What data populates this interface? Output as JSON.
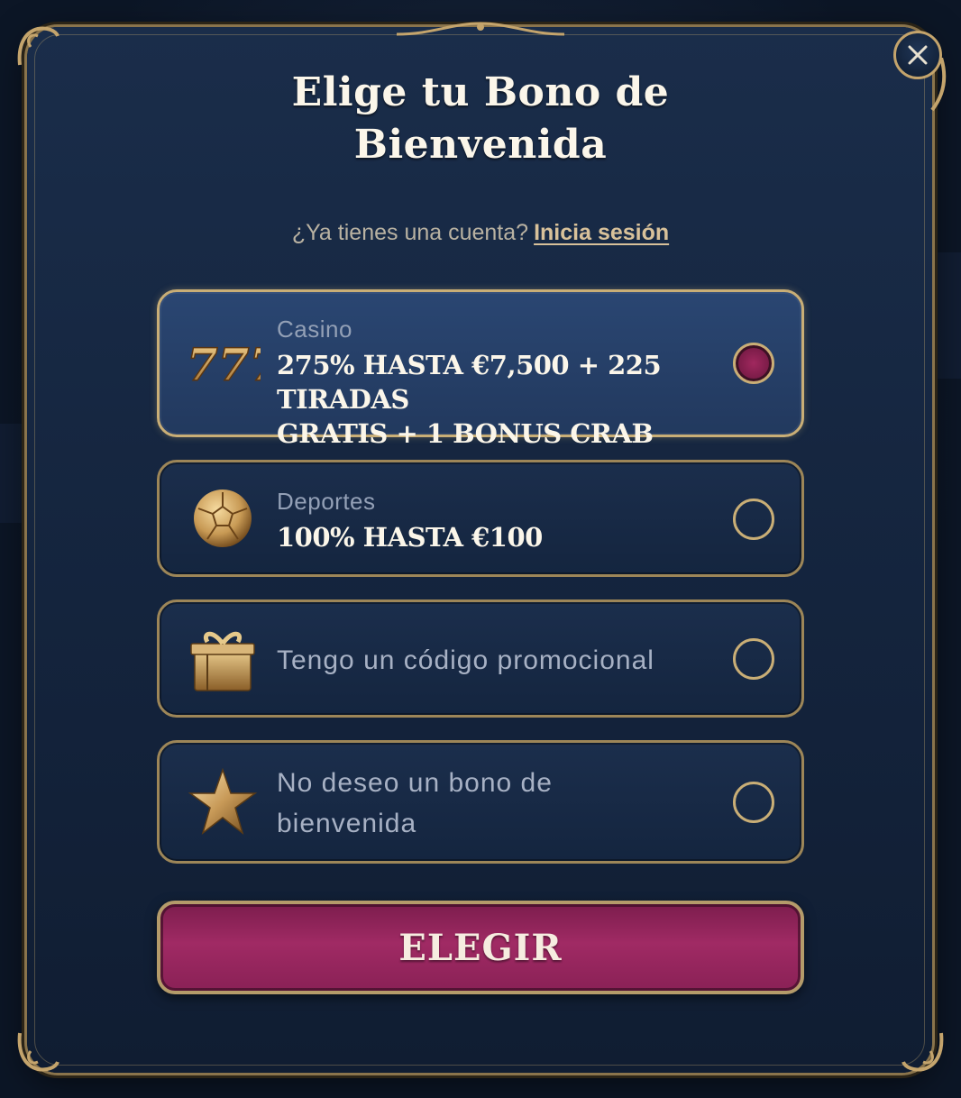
{
  "modal": {
    "title_line1": "Elige tu Bono de",
    "title_line2": "Bienvenida",
    "login_prompt": "¿Ya tienes una cuenta?",
    "login_link": "Inicia sesión",
    "close_icon": "close-icon"
  },
  "options": [
    {
      "icon": "777-slot-icon",
      "category": "Casino",
      "title_line1": "275% HASTA €7,500 + 225 TIRADAS",
      "title_line2": "GRATIS + 1 BONUS CRAB",
      "selected": true
    },
    {
      "icon": "soccer-ball-icon",
      "category": "Deportes",
      "title_line1": "100% HASTA €100",
      "selected": false
    },
    {
      "icon": "gift-icon",
      "text": "Tengo un código promocional",
      "selected": false
    },
    {
      "icon": "star-icon",
      "text_line1": "No deseo un bono de",
      "text_line2": "bienvenida",
      "selected": false
    }
  ],
  "submit": {
    "label": "ELEGIR"
  },
  "colors": {
    "gold": "#c9ae76",
    "accent_magenta": "#a02a64",
    "panel": "#14243d"
  }
}
